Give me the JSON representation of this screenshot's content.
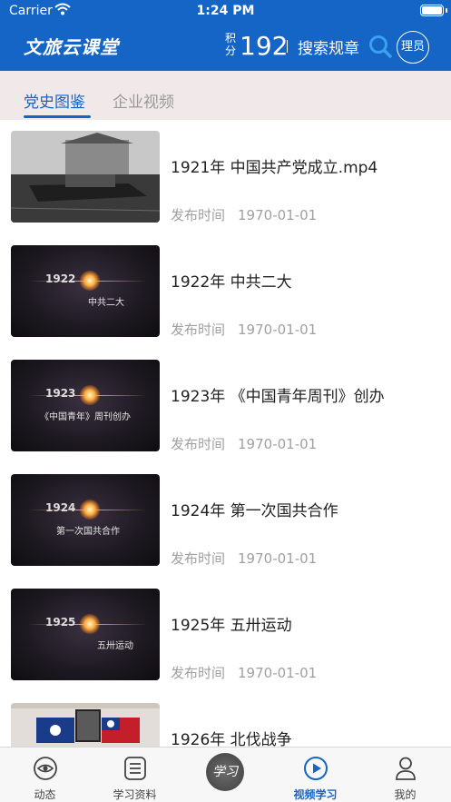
{
  "status_bar": {
    "carrier": "Carrier",
    "time": "1:24 PM"
  },
  "header": {
    "title": "文旅云课堂",
    "points_label": "积分",
    "points_value": "192",
    "rules_label": "搜索规章",
    "user_label": "理员"
  },
  "tabs": [
    {
      "label": "党史图鉴",
      "active": true
    },
    {
      "label": "企业视频",
      "active": false
    }
  ],
  "meta_label": "发布时间",
  "items": [
    {
      "title": "1921年 中国共产党成立.mp4",
      "date": "1970-01-01",
      "thumb_year": "",
      "thumb_caption": ""
    },
    {
      "title": "1922年 中共二大",
      "date": "1970-01-01",
      "thumb_year": "1922",
      "thumb_caption": "中共二大"
    },
    {
      "title": "1923年 《中国青年周刊》创办",
      "date": "1970-01-01",
      "thumb_year": "1923",
      "thumb_caption": "《中国青年》周刊创办"
    },
    {
      "title": "1924年 第一次国共合作",
      "date": "1970-01-01",
      "thumb_year": "1924",
      "thumb_caption": "第一次国共合作"
    },
    {
      "title": "1925年 五卅运动",
      "date": "1970-01-01",
      "thumb_year": "1925",
      "thumb_caption": "五卅运动"
    },
    {
      "title": "1926年 北伐战争",
      "date": "",
      "thumb_year": "",
      "thumb_caption": ""
    }
  ],
  "tabbar": [
    {
      "label": "动态",
      "icon": "eye-icon",
      "active": false
    },
    {
      "label": "学习资料",
      "icon": "document-icon",
      "active": false
    },
    {
      "label": "学习",
      "icon": "study-badge-icon",
      "active": false
    },
    {
      "label": "视频学习",
      "icon": "play-icon",
      "active": true
    },
    {
      "label": "我的",
      "icon": "person-icon",
      "active": false
    }
  ],
  "colors": {
    "brand": "#1565c7",
    "tab_bg": "#f1e9e9",
    "meta": "#a0a0a0"
  }
}
